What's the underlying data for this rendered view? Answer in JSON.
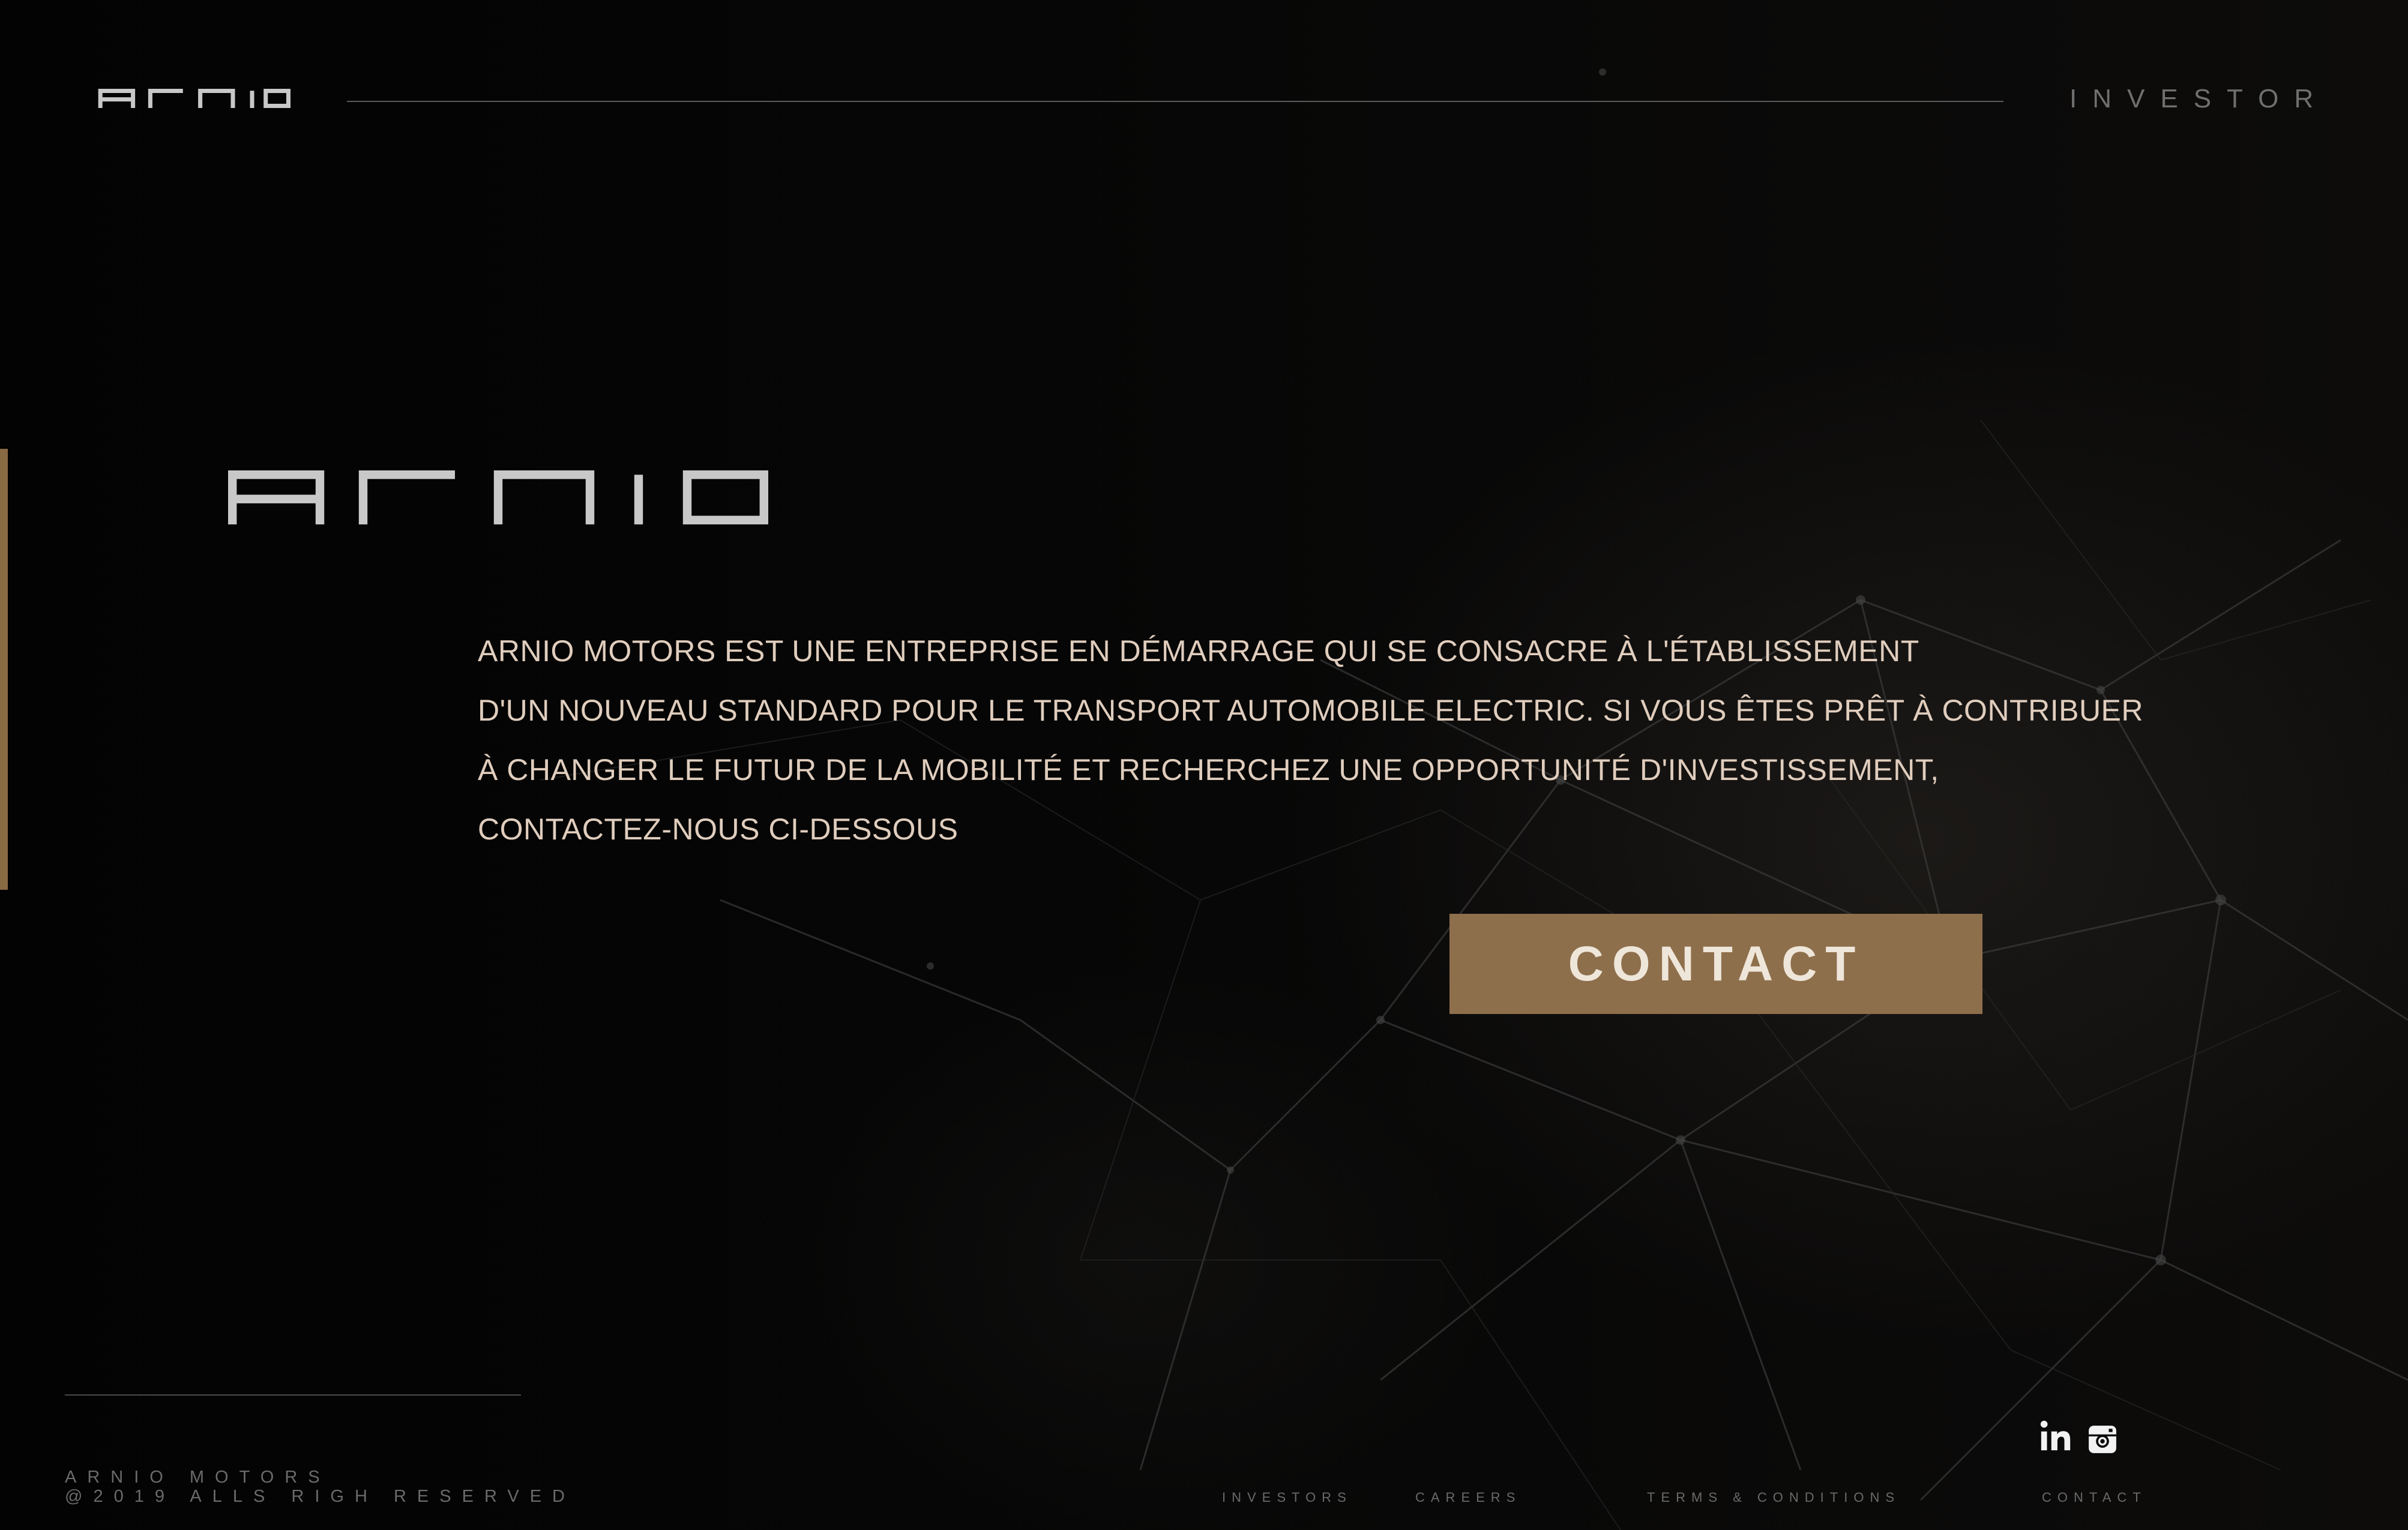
{
  "brand": {
    "name": "ARNIO"
  },
  "header": {
    "nav_investor": "INVESTOR"
  },
  "hero": {
    "lines": [
      "ARNIO MOTORS EST UNE ENTREPRISE EN DÉMARRAGE QUI SE CONSACRE  À L'ÉTABLISSEMENT",
      "D'UN NOUVEAU STANDARD POUR LE TRANSPORT AUTOMOBILE ELECTRIC. SI VOUS ÊTES PRÊT À CONTRIBUER",
      "À CHANGER LE FUTUR DE LA MOBILITÉ ET RECHERCHEZ UNE OPPORTUNITÉ D'INVESTISSEMENT,",
      "CONTACTEZ-NOUS CI-DESSOUS"
    ],
    "contact_button": "CONTACT"
  },
  "footer": {
    "brand_line": "ARNIO MOTORS",
    "copyright": "@2019 ALLS RIGH RESERVED",
    "links": [
      "INVESTORS",
      "CAREERS",
      "TERMS & CONDITIONS",
      "CONTACT"
    ],
    "social": [
      "linkedin-icon",
      "instagram-icon"
    ]
  },
  "colors": {
    "accent": "#8e6f4c",
    "text": "#e0cdbd",
    "logo": "#c8c8c8",
    "muted": "#6a6a6a",
    "background": "#050505"
  }
}
